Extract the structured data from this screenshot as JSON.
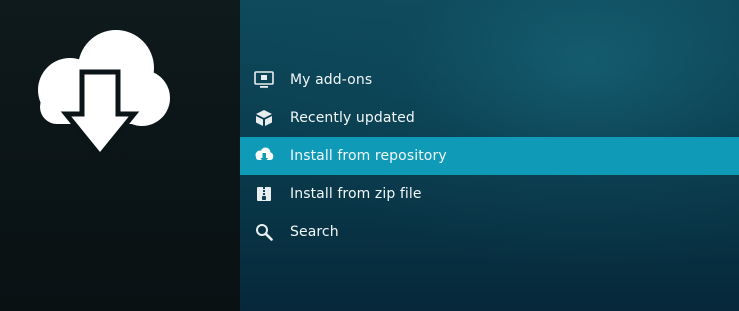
{
  "menu": {
    "items": [
      {
        "label": "My add-ons",
        "icon": "monitor-icon",
        "selected": false
      },
      {
        "label": "Recently updated",
        "icon": "box-icon",
        "selected": false
      },
      {
        "label": "Install from repository",
        "icon": "cloud-download-icon",
        "selected": true
      },
      {
        "label": "Install from zip file",
        "icon": "zip-file-icon",
        "selected": false
      },
      {
        "label": "Search",
        "icon": "search-icon",
        "selected": false
      }
    ]
  },
  "hero": {
    "icon": "cloud-download-icon"
  },
  "colors": {
    "selected_bg": "#0f9ab8",
    "panel_bg": "#0b4153",
    "left_bg": "#0b1416",
    "text": "#f2f7f8"
  }
}
